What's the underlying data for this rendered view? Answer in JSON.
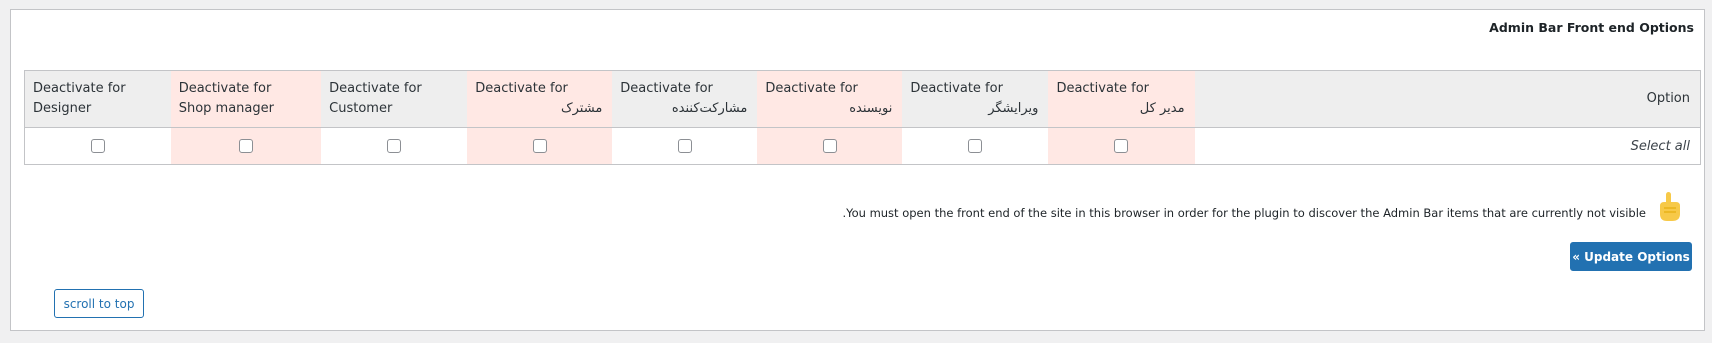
{
  "panel": {
    "title": "Admin Bar Front end Options"
  },
  "table": {
    "option_header": "Option",
    "select_all_label": "Select all",
    "columns": [
      {
        "line1": "Deactivate for",
        "line2": "مدیر کل",
        "tint": "pink"
      },
      {
        "line1": "Deactivate for",
        "line2": "ویرایشگر",
        "tint": "gray"
      },
      {
        "line1": "Deactivate for",
        "line2": "نویسنده",
        "tint": "pink"
      },
      {
        "line1": "Deactivate for",
        "line2": "مشارکت‌کننده",
        "tint": "gray"
      },
      {
        "line1": "Deactivate for",
        "line2": "مشترک",
        "tint": "pink"
      },
      {
        "line1": "Deactivate for",
        "line2": "Customer",
        "tint": "gray"
      },
      {
        "line1": "Deactivate for",
        "line2": "Shop manager",
        "tint": "pink"
      },
      {
        "line1": "Deactivate for",
        "line2": "Designer",
        "tint": "gray"
      }
    ],
    "checkbox_states": [
      false,
      false,
      false,
      false,
      false,
      false,
      false,
      false
    ]
  },
  "notice": {
    "text": ".You must open the front end of the site in this browser in order for the plugin to discover the Admin Bar items that are currently not visible",
    "icon": "pointing-hand-icon"
  },
  "buttons": {
    "update_label": "« Update Options",
    "scroll_top_label": "scroll to top"
  },
  "colors": {
    "accent": "#2271b1",
    "pink_tint": "#ffe8e4",
    "gray_tint": "#eeeeee"
  }
}
